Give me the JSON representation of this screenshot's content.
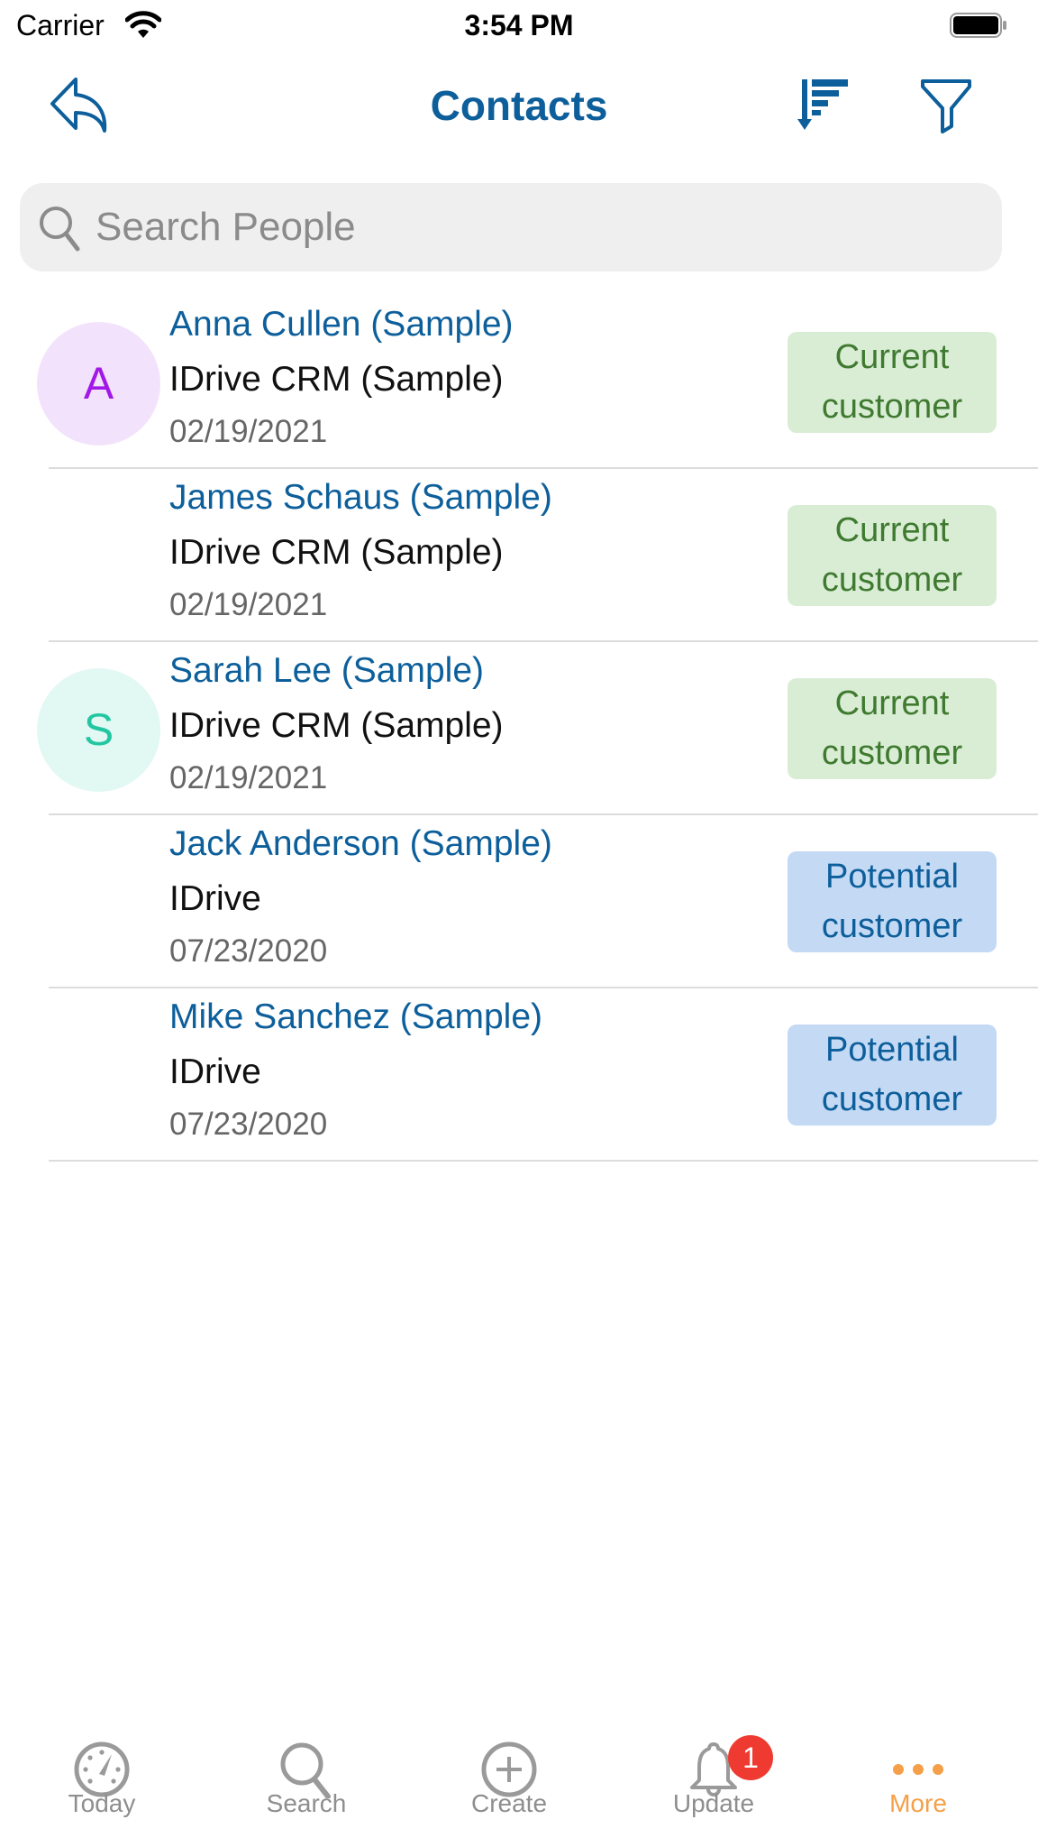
{
  "status_bar": {
    "carrier": "Carrier",
    "time": "3:54 PM",
    "wifi_icon": "wifi-icon",
    "battery_icon": "battery-icon"
  },
  "nav_bar": {
    "title": "Contacts",
    "back_icon": "reply-arrow-icon",
    "sort_icon": "sort-descending-icon",
    "filter_icon": "funnel-filter-icon"
  },
  "search": {
    "placeholder": "Search People",
    "value": ""
  },
  "contacts": [
    {
      "name": "Anna Cullen (Sample)",
      "company": "IDrive CRM (Sample)",
      "date": "02/19/2021",
      "avatar_letter": "A",
      "avatar_bg": "#f3e2fb",
      "avatar_fg": "#a218e6",
      "status_line1": "Current",
      "status_line2": "customer",
      "status_type": "current"
    },
    {
      "name": "James Schaus (Sample)",
      "company": "IDrive CRM (Sample)",
      "date": "02/19/2021",
      "avatar_letter": "",
      "status_line1": "Current",
      "status_line2": "customer",
      "status_type": "current"
    },
    {
      "name": "Sarah Lee (Sample)",
      "company": "IDrive CRM (Sample)",
      "date": "02/19/2021",
      "avatar_letter": "S",
      "avatar_bg": "#e2f8f3",
      "avatar_fg": "#22c7a2",
      "status_line1": "Current",
      "status_line2": "customer",
      "status_type": "current"
    },
    {
      "name": "Jack Anderson (Sample)",
      "company": "IDrive",
      "date": "07/23/2020",
      "avatar_letter": "",
      "status_line1": "Potential",
      "status_line2": "customer",
      "status_type": "potential"
    },
    {
      "name": "Mike Sanchez (Sample)",
      "company": "IDrive",
      "date": "07/23/2020",
      "avatar_letter": "",
      "status_line1": "Potential",
      "status_line2": "customer",
      "status_type": "potential"
    }
  ],
  "status_colors": {
    "current_bg": "#d9edd5",
    "current_fg": "#3f7a30",
    "potential_bg": "#c3d9f4",
    "potential_fg": "#0d5f9b"
  },
  "tab_bar": {
    "tabs": [
      {
        "label": "Today",
        "icon": "speedometer-icon",
        "active": false
      },
      {
        "label": "Search",
        "icon": "search-icon",
        "active": false
      },
      {
        "label": "Create",
        "icon": "plus-circle-icon",
        "active": false
      },
      {
        "label": "Update",
        "icon": "bell-icon",
        "active": false,
        "badge": "1"
      },
      {
        "label": "More",
        "icon": "more-dots-icon",
        "active": true
      }
    ]
  },
  "colors": {
    "accent": "#0d5f9b",
    "tab_active": "#f59f48",
    "tab_inactive": "#8e8e8e",
    "notification": "#ee3a30"
  }
}
